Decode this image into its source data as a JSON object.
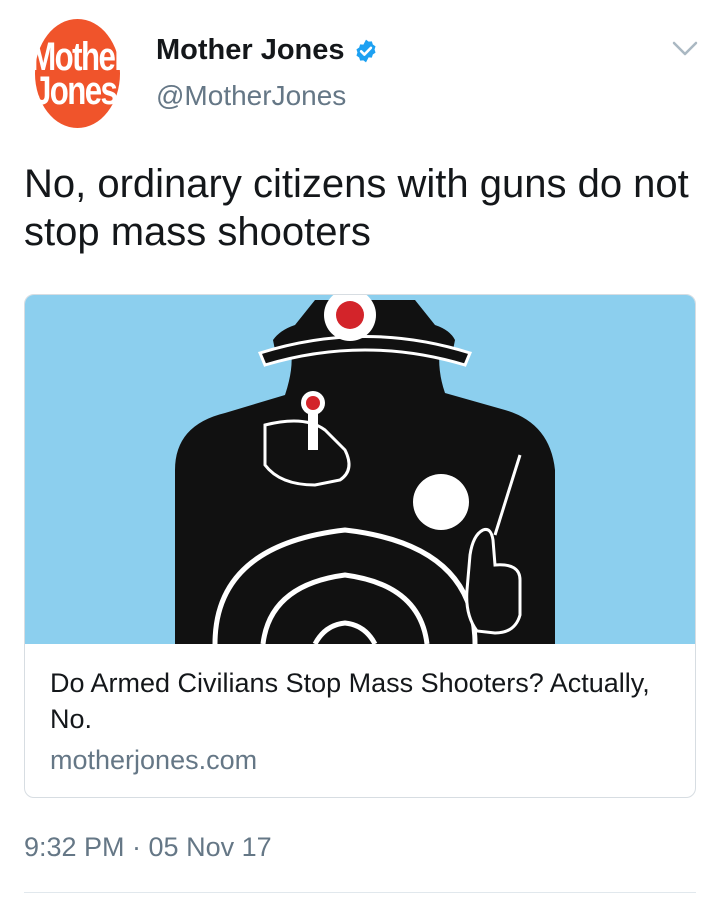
{
  "author": {
    "avatar_line1": "Mother",
    "avatar_line2": "Jones",
    "name": "Mother Jones",
    "handle": "@MotherJones",
    "verified_icon": "verified-badge-icon",
    "avatar_color": "#f0542b"
  },
  "tweet": {
    "text": "No, ordinary citizens with guns do not stop mass shooters"
  },
  "card": {
    "title": "Do Armed Civilians Stop Mass Shooters? Actually, No.",
    "domain": "motherjones.com",
    "image_bg_color": "#8ccfee"
  },
  "meta": {
    "timestamp": "9:32 PM · 05 Nov 17"
  },
  "icons": {
    "menu": "chevron-down-icon"
  }
}
